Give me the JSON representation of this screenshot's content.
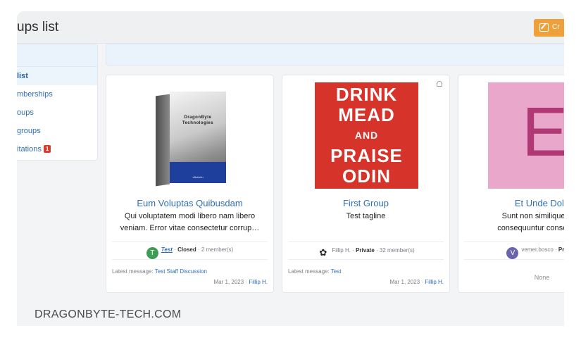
{
  "page": {
    "title": "ups list",
    "create_button_label": "Cr"
  },
  "sidebar": {
    "items": [
      {
        "label": "list",
        "active": true
      },
      {
        "label": "mberships"
      },
      {
        "label": "oups"
      },
      {
        "label": "groups"
      },
      {
        "label": "itations",
        "badge": "1"
      }
    ]
  },
  "cards": [
    {
      "title": "Eum Voluptas Quibusdam",
      "text_line1": "Qui voluptatem modi libero nam libero",
      "text_line2": "veniam. Error vitae consectetur corrup…",
      "image": {
        "brand_line1": "DragonByte",
        "brand_line2": "Technologies",
        "sub": "vBulletin"
      },
      "avatar_letter": "T",
      "owner": "Test",
      "privacy": "Closed",
      "members": "2 member(s)",
      "latest_label": "Latest message:",
      "latest_link": "Test Staff Discussion",
      "date": "Mar 1, 2023",
      "date_user": "Fillip H."
    },
    {
      "title": "First Group",
      "text_line1": "Test tagline",
      "image": {
        "line1": "DRINK",
        "line2": "MEAD",
        "line3": "AND",
        "line4": "PRAISE",
        "line5": "ODIN"
      },
      "owner": "Fillip H.",
      "privacy": "Private",
      "members": "32 member(s)",
      "latest_label": "Latest message:",
      "latest_link": "Test",
      "date": "Mar 1, 2023",
      "date_user": "Fillip H."
    },
    {
      "title": "Et Unde Dolo",
      "text_line1": "Sunt non similique labo",
      "text_line2": "consequuntur consequatu",
      "image": {
        "letter": "E"
      },
      "avatar_letter": "V",
      "owner": "vemer.bosco",
      "privacy": "Private",
      "none_label": "None"
    }
  ],
  "watermark": "DRAGONBYTE-TECH.COM",
  "colors": {
    "accent": "#2f6fb4",
    "create_button": "#f0a03a",
    "badge": "#d23d2f",
    "poster": "#d6332b",
    "pink_tile": "#e9a7cb"
  },
  "icons": [
    "edit-icon",
    "bell-icon",
    "avatar-icon"
  ]
}
